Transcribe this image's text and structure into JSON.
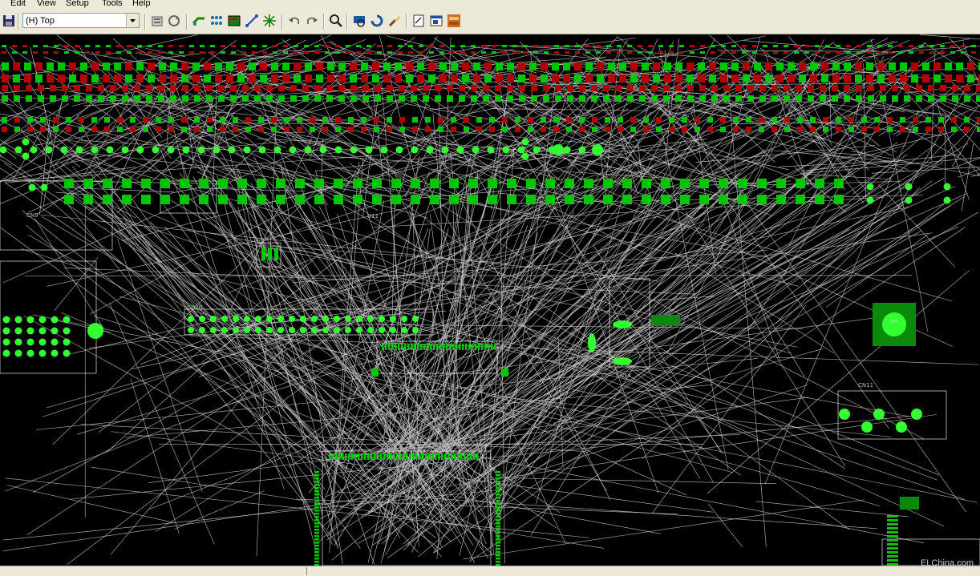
{
  "menu": [
    "Edit",
    "View",
    "Setup",
    "Tools",
    "Help"
  ],
  "toolbar": {
    "layer_value": "(H) Top",
    "buttons": [
      "save-icon",
      "properties-icon",
      "refresh-icon",
      "route-icon",
      "copper-pour-icon",
      "board-icon",
      "add-trace-icon",
      "ratsnest-icon",
      "undo-icon",
      "redo-icon",
      "zoom-icon",
      "view-all-icon",
      "redraw-icon",
      "clean-icon",
      "report-icon",
      "window-icon",
      "pads-logo-icon"
    ]
  },
  "board": {
    "ref_labels": [
      "CN9",
      "U11",
      "CN20",
      "CN18",
      "CN11",
      "U4"
    ],
    "colors": {
      "background": "#000000",
      "ratsnest": "#c8c8c8",
      "pad": "#00c800",
      "pad_bright": "#33ff33",
      "smd_red": "#b40000",
      "outline": "#e6e6e6"
    }
  },
  "watermark": "ELChina.com"
}
